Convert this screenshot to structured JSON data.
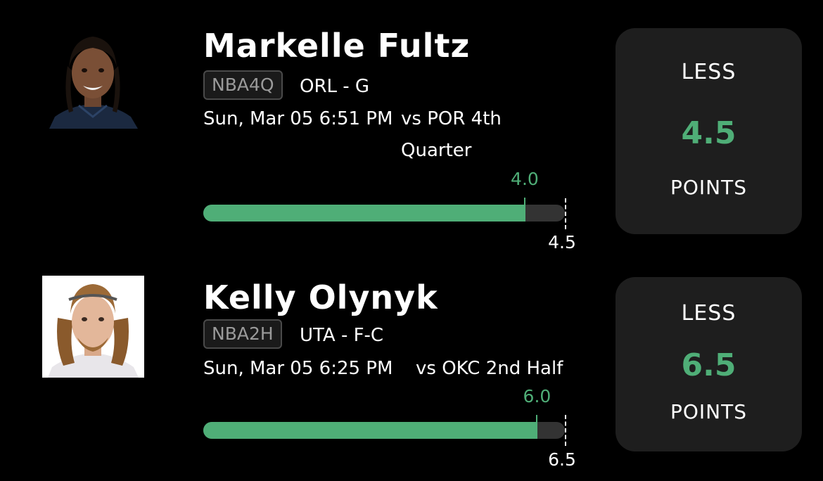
{
  "colors": {
    "background": "#000000",
    "accent": "#4fae77",
    "panel": "#1e1e1e",
    "track": "#333333"
  },
  "picks": [
    {
      "player_name": "Markelle Fultz",
      "league_badge": "NBA4Q",
      "team_position": "ORL - G",
      "game_time": "Sun, Mar 05 6:51 PM",
      "opponent_line1": "vs POR 4th",
      "opponent_line2": "Quarter",
      "current_value": "4.0",
      "line_value": "4.5",
      "progress_fraction": 0.889,
      "pick_direction": "LESS",
      "panel_line": "4.5",
      "stat_type": "POINTS",
      "avatar_icon": "player-photo"
    },
    {
      "player_name": "Kelly Olynyk",
      "league_badge": "NBA2H",
      "team_position": "UTA - F-C",
      "game_time": "Sun, Mar 05 6:25 PM",
      "opponent_line1": "vs OKC 2nd Half",
      "current_value": "6.0",
      "line_value": "6.5",
      "progress_fraction": 0.923,
      "pick_direction": "LESS",
      "panel_line": "6.5",
      "stat_type": "POINTS",
      "avatar_icon": "player-photo"
    }
  ]
}
